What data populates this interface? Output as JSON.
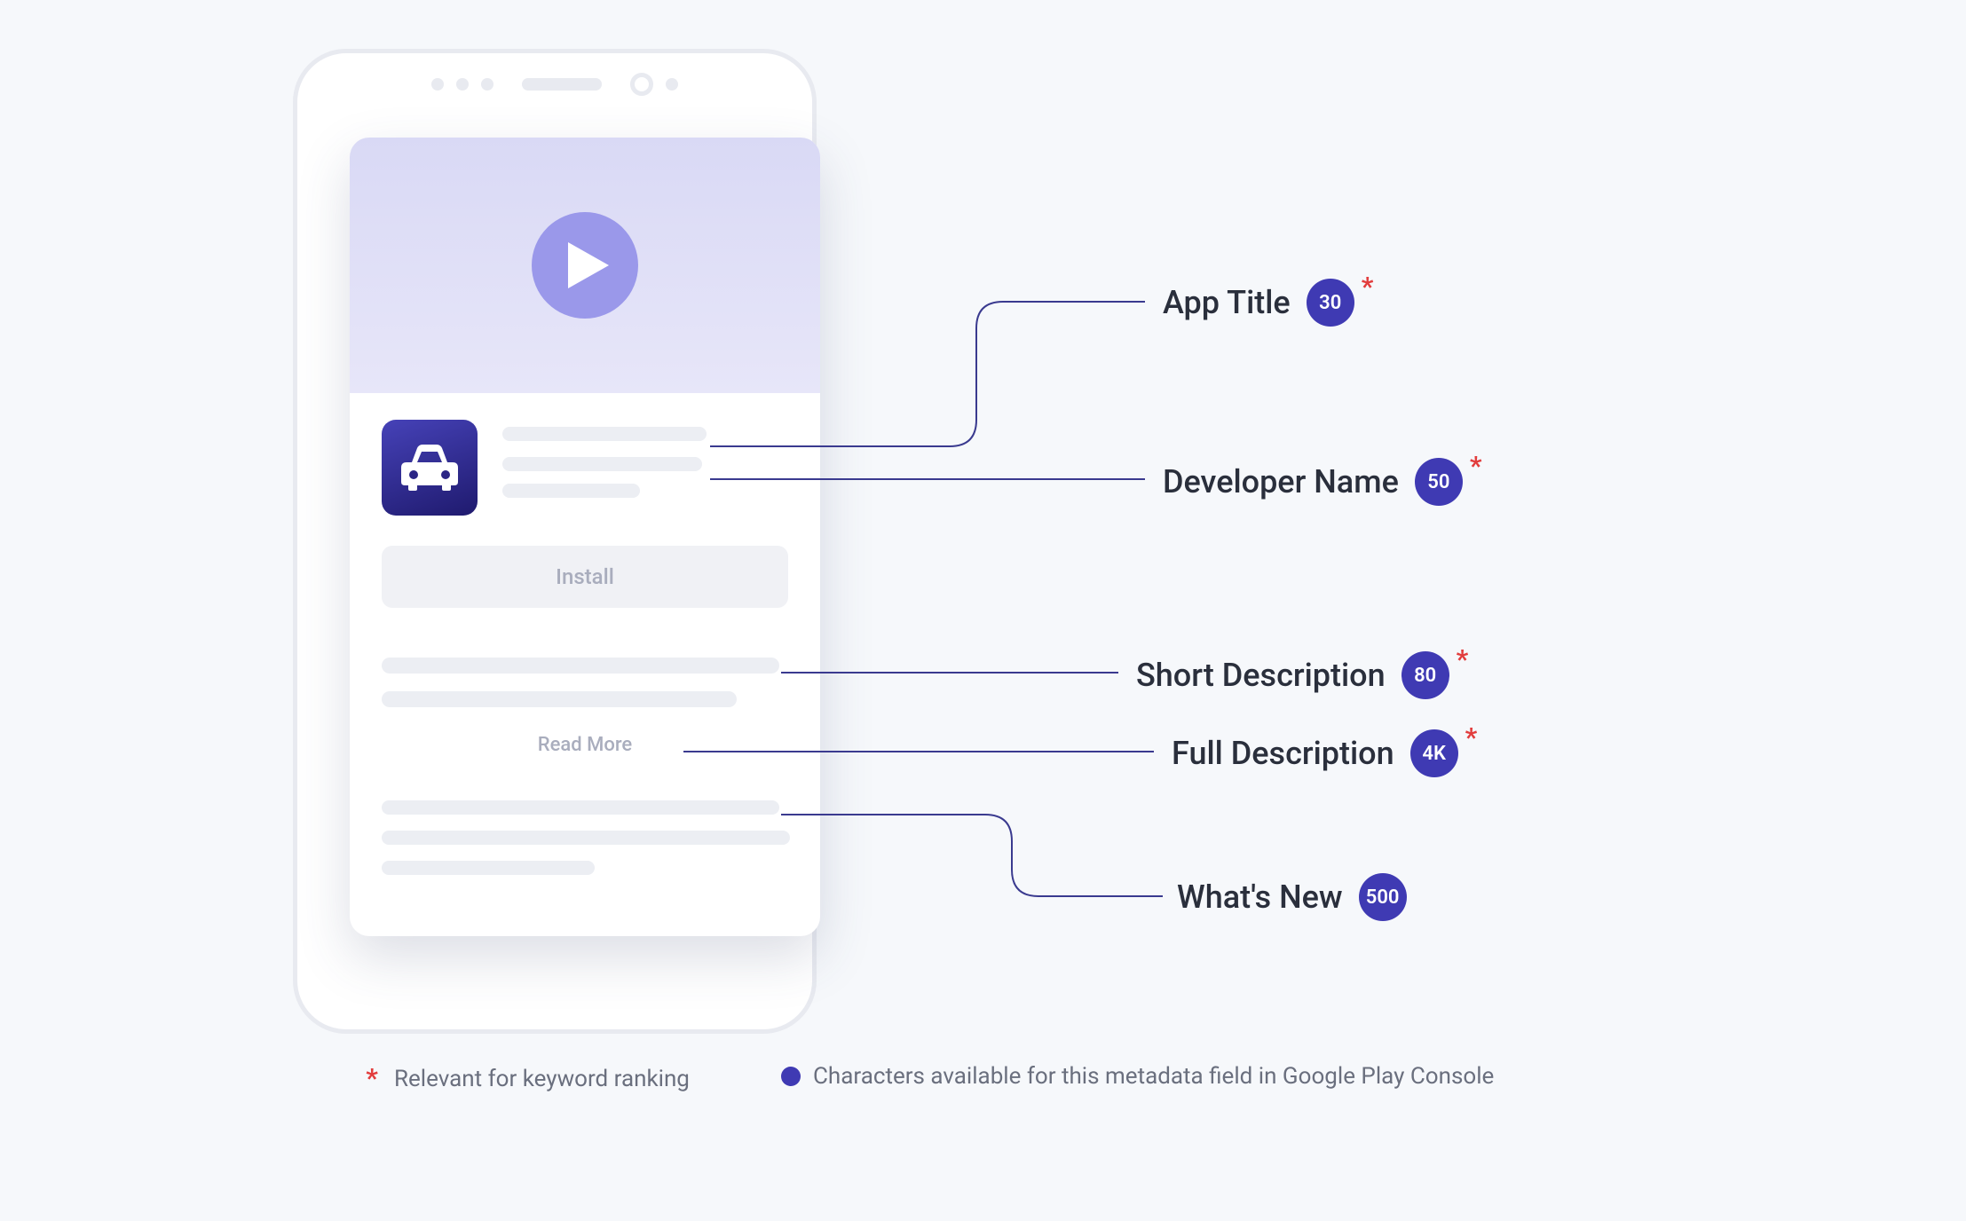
{
  "screen": {
    "install_label": "Install",
    "readmore_label": "Read More"
  },
  "labels": {
    "app_title": {
      "text": "App Title",
      "count": "30",
      "ranked": true
    },
    "developer_name": {
      "text": "Developer Name",
      "count": "50",
      "ranked": true
    },
    "short_description": {
      "text": "Short Description",
      "count": "80",
      "ranked": true
    },
    "full_description": {
      "text": "Full Description",
      "count": "4K",
      "ranked": true
    },
    "whats_new": {
      "text": "What's New",
      "count": "500",
      "ranked": false
    }
  },
  "legend": {
    "ranked_text": "Relevant for keyword ranking",
    "count_text": "Characters available for this metadata field in Google Play Console"
  }
}
